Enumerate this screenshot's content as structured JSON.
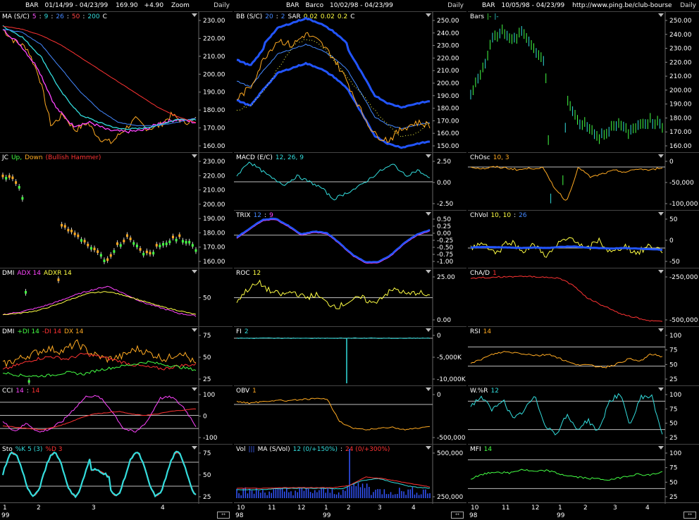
{
  "columns": [
    {
      "id": "c1",
      "title": [
        {
          "text": "BAR",
          "color": "#fff"
        },
        {
          "text": "01/14/99 - 04/23/99",
          "color": "#fff"
        },
        {
          "text": "169.90",
          "color": "#fff"
        },
        {
          "text": "+4.90",
          "color": "#fff"
        },
        {
          "text": "Zoom",
          "color": "#fff"
        }
      ],
      "period": "Daily",
      "panels": [
        {
          "name": "ma",
          "label": [
            {
              "t": "MA (S/C)",
              "c": "#fff"
            },
            {
              "t": "5",
              "c": "#ff55ff"
            },
            {
              "t": ":",
              "c": "#fff"
            },
            {
              "t": "9",
              "c": "#33dddd"
            },
            {
              "t": ":",
              "c": "#fff"
            },
            {
              "t": "26",
              "c": "#4488ff"
            },
            {
              "t": ":",
              "c": "#fff"
            },
            {
              "t": "50",
              "c": "#ff4444"
            },
            {
              "t": ":",
              "c": "#fff"
            },
            {
              "t": "200",
              "c": "#33dddd"
            },
            {
              "t": "C",
              "c": "#fff"
            }
          ],
          "ticks": [
            "230.00",
            "220.00",
            "210.00",
            "200.00",
            "190.00",
            "180.00",
            "170.00",
            "160.00"
          ]
        },
        {
          "name": "jc",
          "label": [
            {
              "t": "JC",
              "c": "#fff"
            },
            {
              "t": "Up,",
              "c": "#44ff44"
            },
            {
              "t": "Down",
              "c": "#ffaa22"
            },
            {
              "t": "(Bullish Hammer)",
              "c": "#ff3333"
            }
          ],
          "ticks": [
            "230.00",
            "220.00",
            "210.00",
            "200.00",
            "190.00",
            "180.00",
            "170.00",
            "160.00"
          ]
        },
        {
          "name": "dmi1",
          "label": [
            {
              "t": "DMI",
              "c": "#fff"
            },
            {
              "t": "ADX 14",
              "c": "#ff44ff"
            },
            {
              "t": "ADXR 14",
              "c": "#ffff44"
            }
          ],
          "ticks": [
            "50"
          ]
        },
        {
          "name": "dmi2",
          "label": [
            {
              "t": "DMI",
              "c": "#fff"
            },
            {
              "t": "+DI 14",
              "c": "#44ff44"
            },
            {
              "t": "-DI 14",
              "c": "#ff3333"
            },
            {
              "t": "DX 14",
              "c": "#ffaa22"
            }
          ],
          "ticks": [
            "75",
            "50",
            "25"
          ]
        },
        {
          "name": "cci",
          "label": [
            {
              "t": "CCI",
              "c": "#fff"
            },
            {
              "t": "14",
              "c": "#ff44ff"
            },
            {
              "t": ":",
              "c": "#fff"
            },
            {
              "t": "14",
              "c": "#ff3333"
            }
          ],
          "ticks": [
            "100",
            "0",
            "-100"
          ]
        },
        {
          "name": "sto",
          "label": [
            {
              "t": "Sto",
              "c": "#fff"
            },
            {
              "t": "%K 5 (3)",
              "c": "#33dddd"
            },
            {
              "t": "%D 3",
              "c": "#ff3333"
            }
          ],
          "ticks": [
            "75",
            "50",
            "25"
          ]
        }
      ],
      "xticks": [
        "1",
        "2",
        "3",
        "4"
      ],
      "year": "99"
    },
    {
      "id": "c2",
      "title": [
        {
          "text": "BAR",
          "color": "#fff"
        },
        {
          "text": "Barco",
          "color": "#fff"
        },
        {
          "text": "10/02/98 - 04/23/99",
          "color": "#fff"
        }
      ],
      "period": "Daily",
      "panels": [
        {
          "name": "bb",
          "label": [
            {
              "t": "BB (S/C)",
              "c": "#fff"
            },
            {
              "t": "20",
              "c": "#4488ff"
            },
            {
              "t": ":",
              "c": "#fff"
            },
            {
              "t": "2",
              "c": "#4488ff"
            },
            {
              "t": "SAR",
              "c": "#fff"
            },
            {
              "t": "0.02",
              "c": "#ffff44"
            },
            {
              "t": "0.02",
              "c": "#ffff44"
            },
            {
              "t": "0.2",
              "c": "#ffff44"
            },
            {
              "t": "C",
              "c": "#fff"
            }
          ],
          "ticks": [
            "250.00",
            "240.00",
            "230.00",
            "220.00",
            "210.00",
            "200.00",
            "190.00",
            "180.00",
            "170.00",
            "160.00",
            "150.00"
          ]
        },
        {
          "name": "macd",
          "label": [
            {
              "t": "MACD (E/C)",
              "c": "#fff"
            },
            {
              "t": "12, 26, 9",
              "c": "#33dddd"
            }
          ],
          "ticks": [
            "2.50",
            "0.00",
            "-2.50"
          ]
        },
        {
          "name": "trix",
          "label": [
            {
              "t": "TRIX",
              "c": "#fff"
            },
            {
              "t": "12",
              "c": "#4488ff"
            },
            {
              "t": ":",
              "c": "#fff"
            },
            {
              "t": "9",
              "c": "#ff44ff"
            }
          ],
          "ticks": [
            "0.50",
            "0.25",
            "0.00",
            "-0.25",
            "-0.50",
            "-0.75",
            "-1.00"
          ]
        },
        {
          "name": "roc",
          "label": [
            {
              "t": "ROC",
              "c": "#fff"
            },
            {
              "t": "12",
              "c": "#ffff44"
            }
          ],
          "ticks": [
            "25.00",
            "0.00"
          ]
        },
        {
          "name": "fi",
          "label": [
            {
              "t": "FI",
              "c": "#fff"
            },
            {
              "t": "2",
              "c": "#33dddd"
            }
          ],
          "ticks": [
            "0",
            "-5,000K",
            "-10,000K"
          ]
        },
        {
          "name": "obv",
          "label": [
            {
              "t": "OBV",
              "c": "#fff"
            },
            {
              "t": "1",
              "c": "#ffaa22"
            }
          ],
          "ticks": [
            "0",
            "-500,000"
          ]
        },
        {
          "name": "vol",
          "label": [
            {
              "t": "Vol",
              "c": "#fff"
            },
            {
              "t": "|||",
              "c": "#4466ff"
            },
            {
              "t": "MA (S/Vol)",
              "c": "#fff"
            },
            {
              "t": "12 (0/+150%)",
              "c": "#33dddd"
            },
            {
              "t": ":",
              "c": "#fff"
            },
            {
              "t": "24 (0/+300%)",
              "c": "#ff3333"
            }
          ],
          "ticks": [
            "500,000",
            "250,000"
          ]
        }
      ],
      "xticks": [
        "10",
        "11",
        "12",
        "1",
        "2",
        "3",
        "4"
      ],
      "year": "99",
      "year0": "98"
    },
    {
      "id": "c3",
      "title": [
        {
          "text": "BAR",
          "color": "#fff"
        },
        {
          "text": "10/05/98 - 04/23/99",
          "color": "#fff"
        },
        {
          "text": "http://www.ping.be/club-bourse",
          "color": "#fff"
        }
      ],
      "period": "Daily",
      "panels": [
        {
          "name": "bars",
          "label": [
            {
              "t": "Bars",
              "c": "#fff"
            },
            {
              "t": "|-",
              "c": "#44ff44"
            },
            {
              "t": "|-",
              "c": "#33dddd"
            }
          ],
          "ticks": [
            "250.00",
            "240.00",
            "230.00",
            "220.00",
            "210.00",
            "200.00",
            "190.00",
            "180.00",
            "170.00",
            "160.00"
          ]
        },
        {
          "name": "chosc",
          "label": [
            {
              "t": "ChOsc",
              "c": "#fff"
            },
            {
              "t": "10, 3",
              "c": "#ffaa22"
            }
          ],
          "ticks": [
            "0",
            "-50,000",
            "-100,000"
          ]
        },
        {
          "name": "chvol",
          "label": [
            {
              "t": "ChVol",
              "c": "#fff"
            },
            {
              "t": "10, 10",
              "c": "#ffff44"
            },
            {
              "t": ":",
              "c": "#fff"
            },
            {
              "t": "26",
              "c": "#4488ff"
            }
          ],
          "ticks": [
            "50",
            "0",
            "-50"
          ]
        },
        {
          "name": "chad",
          "label": [
            {
              "t": "ChA/D",
              "c": "#fff"
            },
            {
              "t": "1",
              "c": "#ff3333"
            }
          ],
          "ticks": [
            "-250,000",
            "-500,000"
          ]
        },
        {
          "name": "rsi",
          "label": [
            {
              "t": "RSI",
              "c": "#fff"
            },
            {
              "t": "14",
              "c": "#ffaa22"
            }
          ],
          "ticks": [
            "100",
            "75",
            "50",
            "25"
          ]
        },
        {
          "name": "wr",
          "label": [
            {
              "t": "W.%R",
              "c": "#fff"
            },
            {
              "t": "12",
              "c": "#33dddd"
            }
          ],
          "ticks": [
            "100",
            "75",
            "50",
            "25"
          ]
        },
        {
          "name": "mfi",
          "label": [
            {
              "t": "MFI",
              "c": "#fff"
            },
            {
              "t": "14",
              "c": "#44ff44"
            }
          ],
          "ticks": [
            "100",
            "75",
            "50",
            "25"
          ]
        }
      ],
      "xticks": [
        "10",
        "11",
        "12",
        "1",
        "2",
        "3",
        "4"
      ],
      "year": "99",
      "year0": "98"
    }
  ]
}
